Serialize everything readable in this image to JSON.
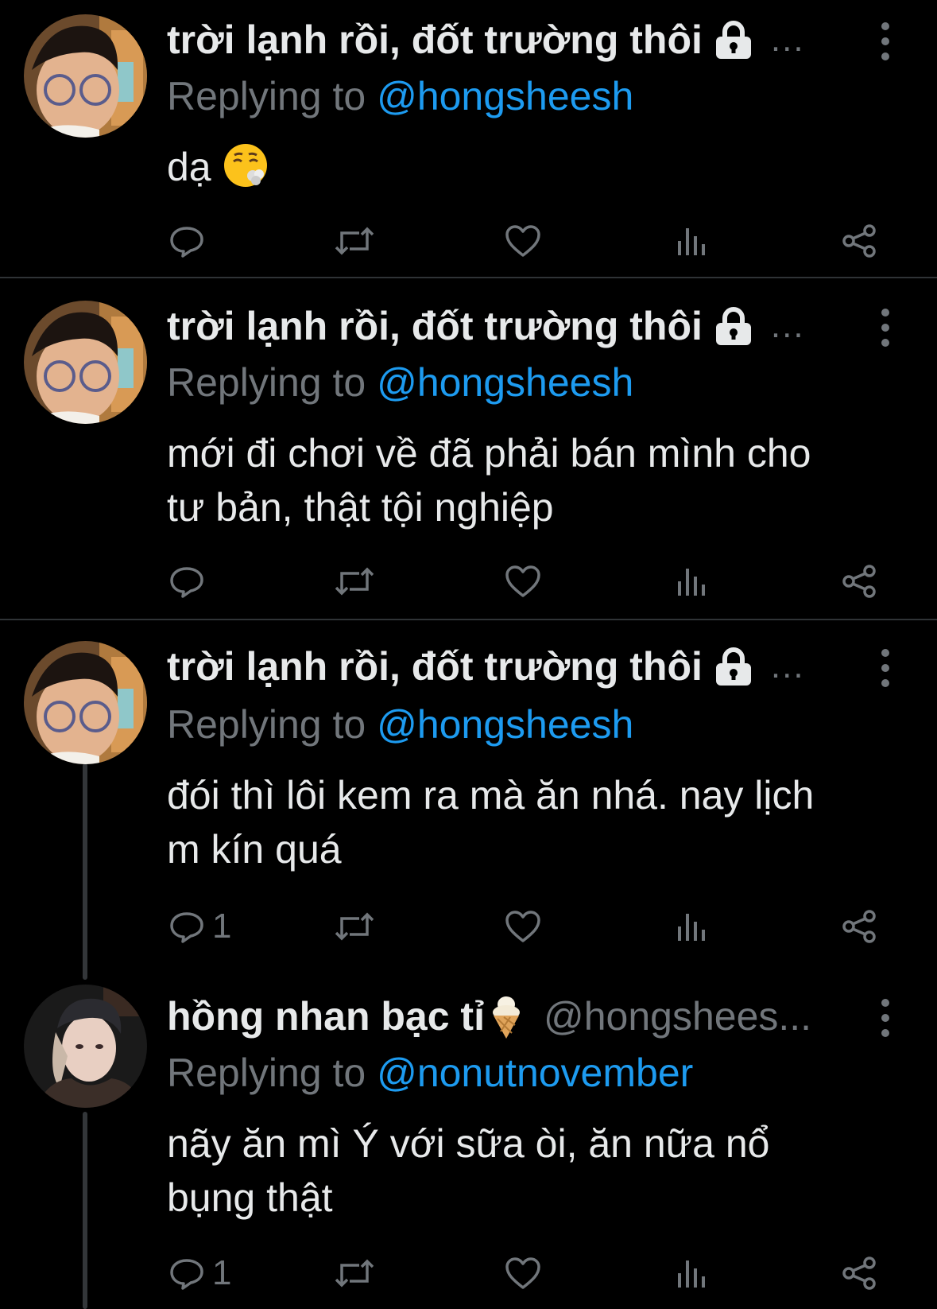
{
  "tweets": [
    {
      "name": "trời lạnh rồi, đốt trường thôi",
      "overflow": "...",
      "replying_prefix": "Replying to",
      "mention": "@hongsheesh",
      "text": "dạ",
      "reply_count": ""
    },
    {
      "name": "trời lạnh rồi, đốt trường thôi",
      "overflow": "...",
      "replying_prefix": "Replying to",
      "mention": "@hongsheesh",
      "text_line1": "mới đi chơi về đã phải bán mình cho",
      "text_line2": "tư bản, thật tội nghiệp",
      "reply_count": ""
    },
    {
      "name": "trời lạnh rồi, đốt trường thôi",
      "overflow": "...",
      "replying_prefix": "Replying to",
      "mention": "@hongsheesh",
      "text_line1": "đói thì lôi kem ra mà ăn nhá. nay lịch",
      "text_line2": "m kín quá",
      "reply_count": "1"
    },
    {
      "name": "hồng nhan bạc tỉ",
      "handle": "@hongshees...",
      "replying_prefix": "Replying to",
      "mention": "@nonutnovember",
      "text_line1": "nãy ăn mì Ý với sữa òi, ăn nữa nổ",
      "text_line2": "bụng thật",
      "reply_count": "1"
    }
  ],
  "icons": [
    "lock-icon",
    "more-icon",
    "emoji-exhale-icon",
    "ice-cream-icon",
    "reply-icon",
    "retweet-icon",
    "like-icon",
    "views-icon",
    "share-icon"
  ],
  "colors": {
    "background": "#000000",
    "text": "#e7e9ea",
    "secondary": "#71767b",
    "link": "#1d9bf0",
    "divider": "#2f3336"
  }
}
